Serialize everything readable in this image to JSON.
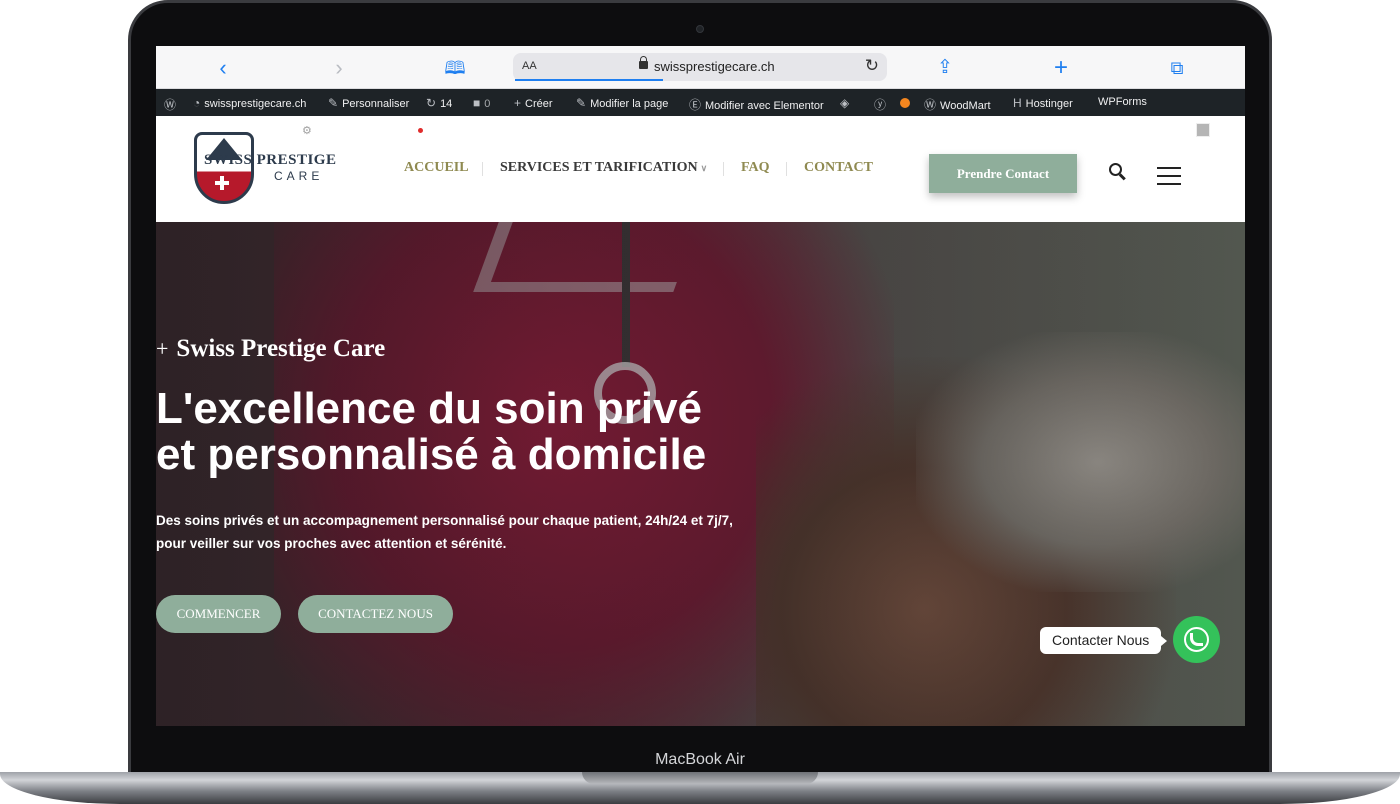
{
  "device": {
    "brand_label": "MacBook Air"
  },
  "browser": {
    "back_icon": "chevron-left-icon",
    "forward_icon": "chevron-right-icon",
    "bookmarks_icon": "book-icon",
    "text_size_label": "AA",
    "url": "swissprestigecare.ch",
    "share_icon": "share-icon",
    "new_tab_icon": "plus-icon",
    "tabs_icon": "tabs-icon",
    "accent_color": "#1f7ff0"
  },
  "admin_bar": {
    "site_name": "swissprestigecare.ch",
    "customize": "Personnaliser",
    "updates_count": "14",
    "comments_count": "0",
    "create": "Créer",
    "edit_page": "Modifier la page",
    "edit_elementor": "Modifier avec Elementor",
    "woodmart": "WoodMart",
    "hostinger": "Hostinger",
    "wpforms": "WPForms"
  },
  "header": {
    "logo_line1": "SWISS PRESTIGE",
    "logo_line2": "CARE",
    "nav": [
      {
        "label": "ACCUEIL"
      },
      {
        "label": "SERVICES ET TARIFICATION"
      },
      {
        "label": "FAQ"
      },
      {
        "label": "CONTACT"
      }
    ],
    "cta_label": "Prendre Contact",
    "brand_color": "#8fae9b",
    "nav_gold_color": "#8f8a51"
  },
  "hero": {
    "kicker_plus": "+",
    "kicker": "Swiss Prestige Care",
    "title_line1": "L'excellence du soin privé",
    "title_line2": "et personnalisé à domicile",
    "subtitle_line1": "Des soins privés et un accompagnement personnalisé pour chaque patient, 24h/24 et 7j/7,",
    "subtitle_line2": "pour veiller sur vos proches avec attention et sérénité.",
    "primary_button": "COMMENCER",
    "secondary_button": "CONTACTEZ NOUS"
  },
  "whatsapp": {
    "label": "Contacter Nous",
    "color": "#34c25a"
  }
}
